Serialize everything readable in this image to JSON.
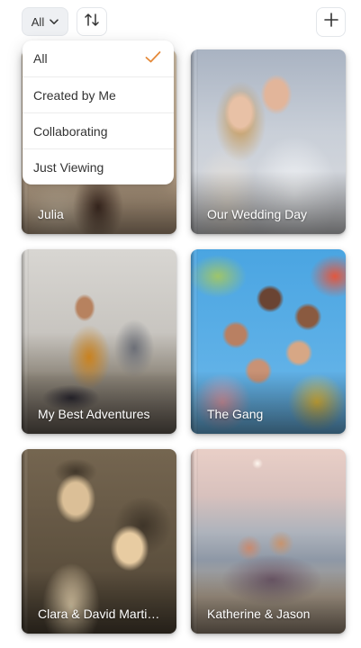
{
  "toolbar": {
    "filter_label": "All",
    "filter_icon": "chevron-down-icon",
    "sort_icon": "sort-arrows-icon",
    "add_icon": "plus-icon"
  },
  "filter_menu": {
    "options": [
      {
        "label": "All",
        "selected": true
      },
      {
        "label": "Created by Me",
        "selected": false
      },
      {
        "label": "Collaborating",
        "selected": false
      },
      {
        "label": "Just Viewing",
        "selected": false
      }
    ],
    "check_color": "#e58a3a"
  },
  "albums": [
    {
      "title": "Julia"
    },
    {
      "title": "Our Wedding Day"
    },
    {
      "title": "My Best Adventures"
    },
    {
      "title": "The Gang"
    },
    {
      "title": "Clara & David Marti…"
    },
    {
      "title": "Katherine & Jason"
    }
  ]
}
